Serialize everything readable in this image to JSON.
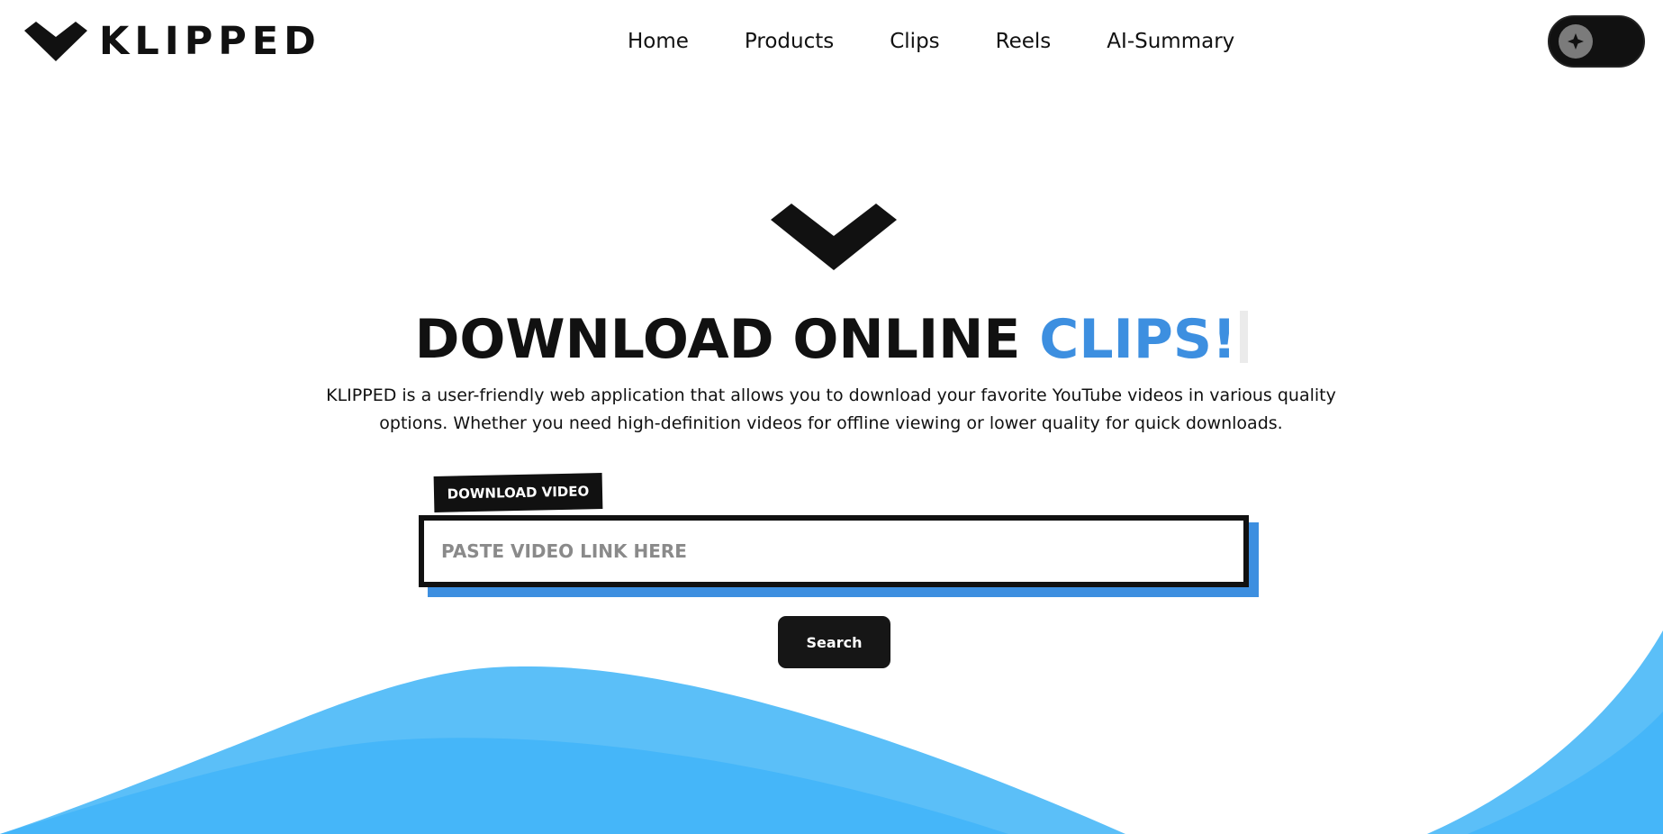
{
  "brand": {
    "name": "KLIPPED",
    "logo_icon": "chevron-down-icon"
  },
  "nav": {
    "items": [
      {
        "label": "Home"
      },
      {
        "label": "Products"
      },
      {
        "label": "Clips"
      },
      {
        "label": "Reels"
      },
      {
        "label": "AI-Summary"
      }
    ]
  },
  "theme_toggle": {
    "icon": "star-icon"
  },
  "hero": {
    "icon": "chevron-down-icon",
    "title_main": "DOWNLOAD ONLINE ",
    "title_accent": "CLIPS!",
    "description": "KLIPPED is a user-friendly web application that allows you to download your favorite YouTube videos in various quality options. Whether you need high-definition videos for offline viewing or lower quality for quick downloads."
  },
  "download_form": {
    "tag_label": "DOWNLOAD VIDEO",
    "input_placeholder": "PASTE VIDEO LINK HERE",
    "input_value": "",
    "search_label": "Search"
  },
  "colors": {
    "accent": "#3d8fe0",
    "wave_light": "#5bbff8",
    "wave_mid": "#45b6f9",
    "dark": "#111111"
  }
}
